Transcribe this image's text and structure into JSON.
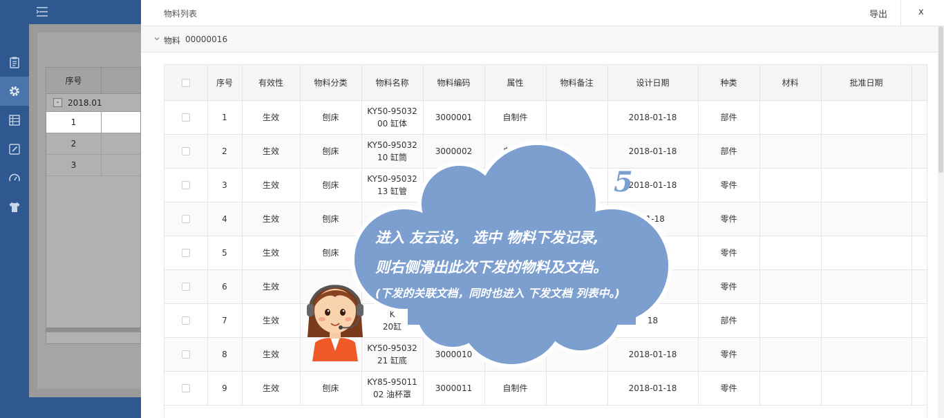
{
  "sidebar": {
    "icons": [
      "clipboard-icon",
      "gear-icon",
      "list-icon",
      "edit-icon",
      "speedometer-icon",
      "shirt-icon"
    ],
    "active_index": 1
  },
  "background_grid": {
    "header": "序号",
    "group_label": "2018.01",
    "group_toggle": "-",
    "rows": [
      "1",
      "2",
      "3"
    ],
    "selected_row": "1"
  },
  "panel": {
    "title": "物料列表",
    "export_label": "导出",
    "close_label": "x",
    "sub_label": "物料",
    "sub_code": "00000016"
  },
  "table": {
    "columns": [
      "序号",
      "有效性",
      "物料分类",
      "物料名称",
      "物料编码",
      "属性",
      "物料备注",
      "设计日期",
      "种类",
      "材料",
      "批准日期"
    ],
    "rows": [
      {
        "no": "1",
        "validity": "生效",
        "category": "刨床",
        "name_a": "KY50-95032",
        "name_b": "00 缸体",
        "code": "3000001",
        "attr": "自制件",
        "remark": "",
        "date": "2018-01-18",
        "kind": "部件",
        "material": "",
        "approve": ""
      },
      {
        "no": "2",
        "validity": "生效",
        "category": "刨床",
        "name_a": "KY50-95032",
        "name_b": "10 缸筒",
        "code": "3000002",
        "attr": "自制件",
        "remark": "",
        "date": "2018-01-18",
        "kind": "部件",
        "material": "",
        "approve": ""
      },
      {
        "no": "3",
        "validity": "生效",
        "category": "刨床",
        "name_a": "KY50-95032",
        "name_b": "13 缸管",
        "code": "300000",
        "attr": "",
        "remark": "",
        "date": "2018-01-18",
        "kind": "零件",
        "material": "",
        "approve": ""
      },
      {
        "no": "4",
        "validity": "生效",
        "category": "刨床",
        "name_a": "KY50-9",
        "name_b": "",
        "code": "",
        "attr": "",
        "remark": "",
        "date": "01-18",
        "kind": "零件",
        "material": "",
        "approve": ""
      },
      {
        "no": "5",
        "validity": "生效",
        "category": "刨床",
        "name_a": "",
        "name_b": "",
        "code": "",
        "attr": "",
        "remark": "",
        "date": "",
        "kind": "零件",
        "material": "",
        "approve": ""
      },
      {
        "no": "6",
        "validity": "生效",
        "category": "",
        "name_a": "",
        "name_b": "",
        "code": "",
        "attr": "",
        "remark": "",
        "date": "",
        "kind": "零件",
        "material": "",
        "approve": ""
      },
      {
        "no": "7",
        "validity": "生效",
        "category": "",
        "name_a": "K",
        "name_b": "20缸",
        "code": "",
        "attr": "",
        "remark": "",
        "date": "18",
        "kind": "部件",
        "material": "",
        "approve": ""
      },
      {
        "no": "8",
        "validity": "生效",
        "category": "",
        "name_a": "KY50-95032",
        "name_b": "21 缸底",
        "code": "3000010",
        "attr": "",
        "remark": "",
        "date": "2018-01-18",
        "kind": "零件",
        "material": "",
        "approve": ""
      },
      {
        "no": "9",
        "validity": "生效",
        "category": "刨床",
        "name_a": "KY85-95011",
        "name_b": "02 油杯罩",
        "code": "3000011",
        "attr": "自制件",
        "remark": "",
        "date": "2018-01-18",
        "kind": "零件",
        "material": "",
        "approve": ""
      }
    ]
  },
  "overlay": {
    "step": "5",
    "line1": "进入 友云设， 选中 物料下发记录,",
    "line2": "则右侧滑出此次下发的物料及文档。",
    "line3": "(下发的关联文档，同时也进入 下发文档 列表中。)",
    "cloud_color": "#7d9fcf"
  }
}
